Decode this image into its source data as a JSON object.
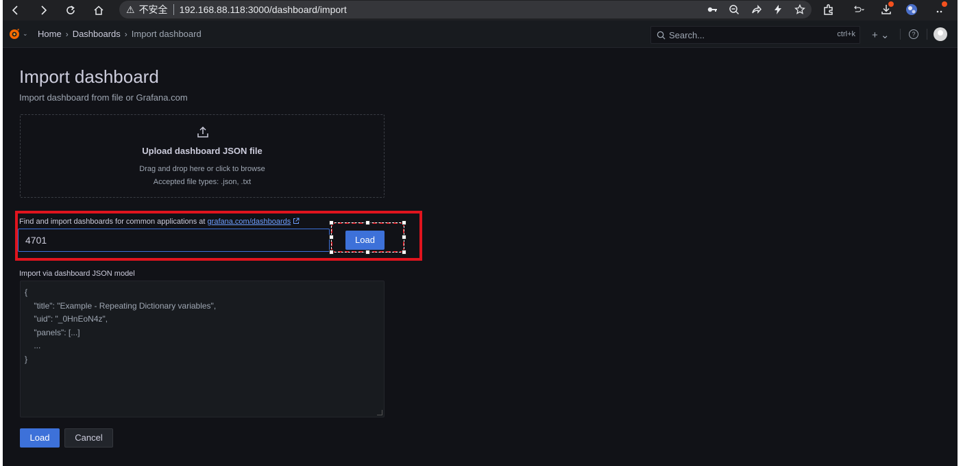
{
  "browser": {
    "insecure_label": "不安全",
    "url": "192.168.88.118:3000/dashboard/import"
  },
  "topbar": {
    "breadcrumbs": [
      "Home",
      "Dashboards",
      "Import dashboard"
    ],
    "search_placeholder": "Search...",
    "search_shortcut": "ctrl+k",
    "plus_label": "+ ⌄",
    "help_label": "?"
  },
  "page": {
    "title": "Import dashboard",
    "subtitle": "Import dashboard from file or Grafana.com"
  },
  "upload": {
    "title": "Upload dashboard JSON file",
    "hint": "Drag and drop here or click to browse",
    "types": "Accepted file types: .json, .txt"
  },
  "gcom": {
    "label_prefix": "Find and import dashboards for common applications at ",
    "link_text": "grafana.com/dashboards",
    "input_value": "4701",
    "load_label": "Load"
  },
  "json_model": {
    "label": "Import via dashboard JSON model",
    "placeholder": "{\n    \"title\": \"Example - Repeating Dictionary variables\",\n    \"uid\": \"_0HnEoN4z\",\n    \"panels\": [...]\n    ...\n}"
  },
  "actions": {
    "load_label": "Load",
    "cancel_label": "Cancel"
  },
  "colors": {
    "accent": "#3d71d9",
    "annotation": "#e0141e",
    "background": "#111217"
  }
}
